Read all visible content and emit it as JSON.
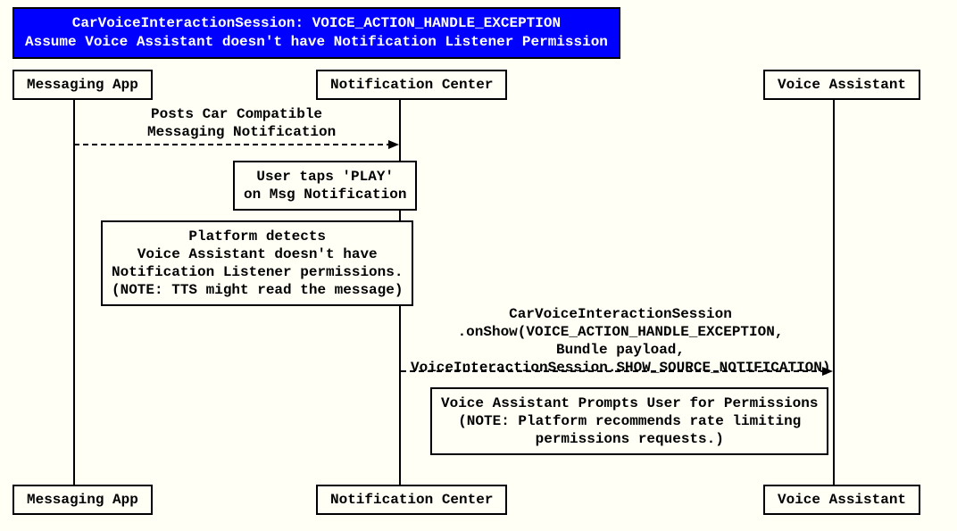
{
  "title": {
    "line1": "CarVoiceInteractionSession: VOICE_ACTION_HANDLE_EXCEPTION",
    "line2": "Assume Voice Assistant doesn't have Notification Listener Permission"
  },
  "participants": {
    "p1_top": "Messaging App",
    "p2_top": "Notification Center",
    "p3_top": "Voice Assistant",
    "p1_bot": "Messaging App",
    "p2_bot": "Notification Center",
    "p3_bot": "Voice Assistant"
  },
  "messages": {
    "m1_label": "Posts Car Compatible\nMessaging Notification",
    "m2_label": "CarVoiceInteractionSession\n.onShow(VOICE_ACTION_HANDLE_EXCEPTION,\nBundle payload,\nVoiceInteractionSession.SHOW_SOURCE_NOTIFICATION)"
  },
  "notes": {
    "n1": "User taps 'PLAY'\non Msg Notification",
    "n2": "Platform detects\nVoice Assistant doesn't have\nNotification Listener permissions.\n(NOTE: TTS might read the message)",
    "n3": "Voice Assistant Prompts User for Permissions\n(NOTE: Platform recommends rate limiting\npermissions requests.)"
  },
  "chart_data": {
    "type": "sequence-diagram",
    "title": "CarVoiceInteractionSession: VOICE_ACTION_HANDLE_EXCEPTION",
    "subtitle": "Assume Voice Assistant doesn't have Notification Listener Permission",
    "participants": [
      "Messaging App",
      "Notification Center",
      "Voice Assistant"
    ],
    "events": [
      {
        "type": "message",
        "from": "Messaging App",
        "to": "Notification Center",
        "style": "dashed",
        "text": "Posts Car Compatible Messaging Notification"
      },
      {
        "type": "note",
        "over": [
          "Notification Center"
        ],
        "text": "User taps 'PLAY' on Msg Notification"
      },
      {
        "type": "note",
        "over": [
          "Messaging App",
          "Notification Center"
        ],
        "text": "Platform detects Voice Assistant doesn't have Notification Listener permissions. (NOTE: TTS might read the message)"
      },
      {
        "type": "message",
        "from": "Notification Center",
        "to": "Voice Assistant",
        "style": "dashed",
        "text": "CarVoiceInteractionSession.onShow(VOICE_ACTION_HANDLE_EXCEPTION, Bundle payload, VoiceInteractionSession.SHOW_SOURCE_NOTIFICATION)"
      },
      {
        "type": "note",
        "over": [
          "Notification Center",
          "Voice Assistant"
        ],
        "text": "Voice Assistant Prompts User for Permissions (NOTE: Platform recommends rate limiting permissions requests.)"
      }
    ]
  }
}
